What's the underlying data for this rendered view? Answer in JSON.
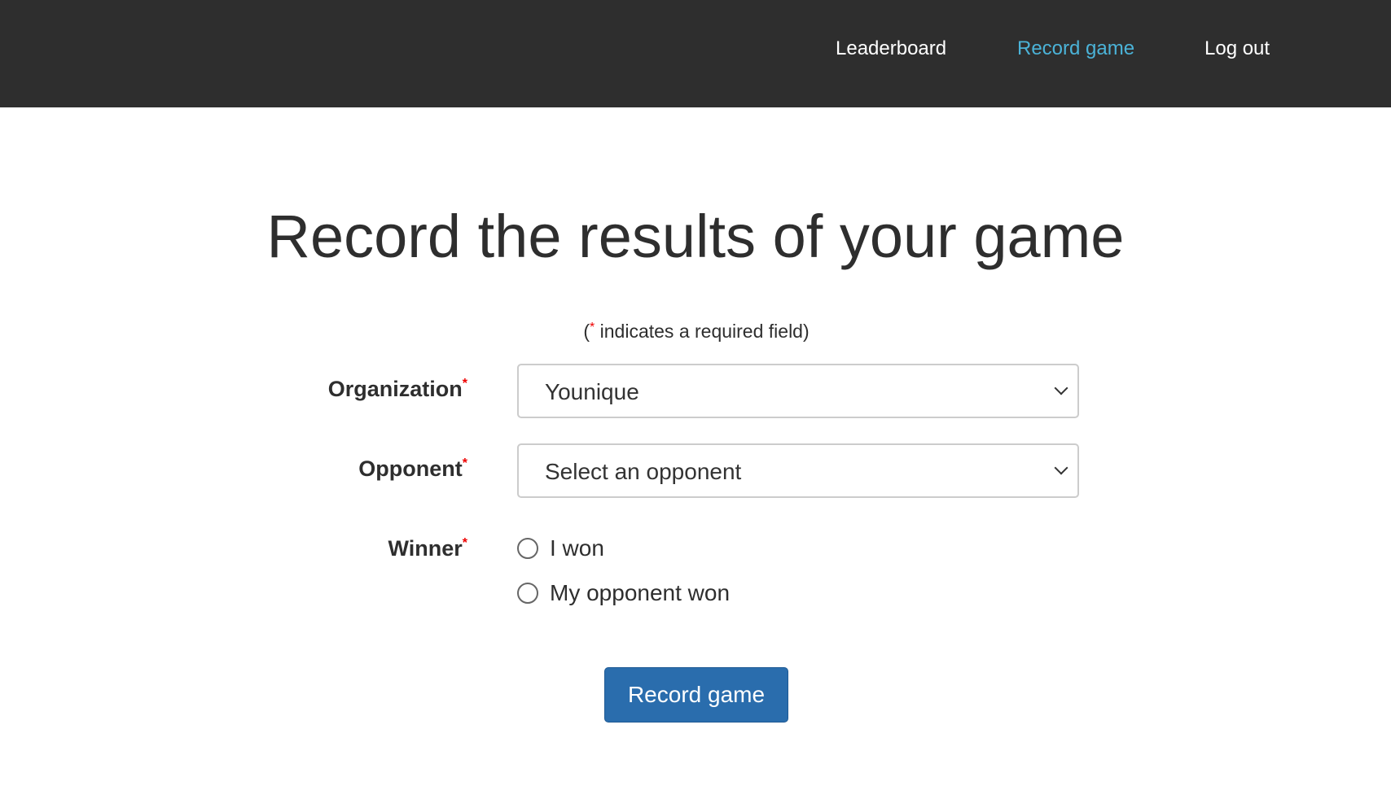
{
  "nav": {
    "leaderboard": "Leaderboard",
    "record_game": "Record game",
    "logout": "Log out",
    "active_color": "#4bb3d8"
  },
  "page": {
    "title": "Record the results of your game",
    "note_open": "(",
    "note_star": "*",
    "note_text": " indicates a required field)"
  },
  "form": {
    "organization": {
      "label": "Organization",
      "value": "Younique"
    },
    "opponent": {
      "label": "Opponent",
      "value": "Select an opponent"
    },
    "winner": {
      "label": "Winner",
      "options": [
        "I won",
        "My opponent won"
      ]
    },
    "required_mark": "*",
    "submit": "Record game"
  }
}
